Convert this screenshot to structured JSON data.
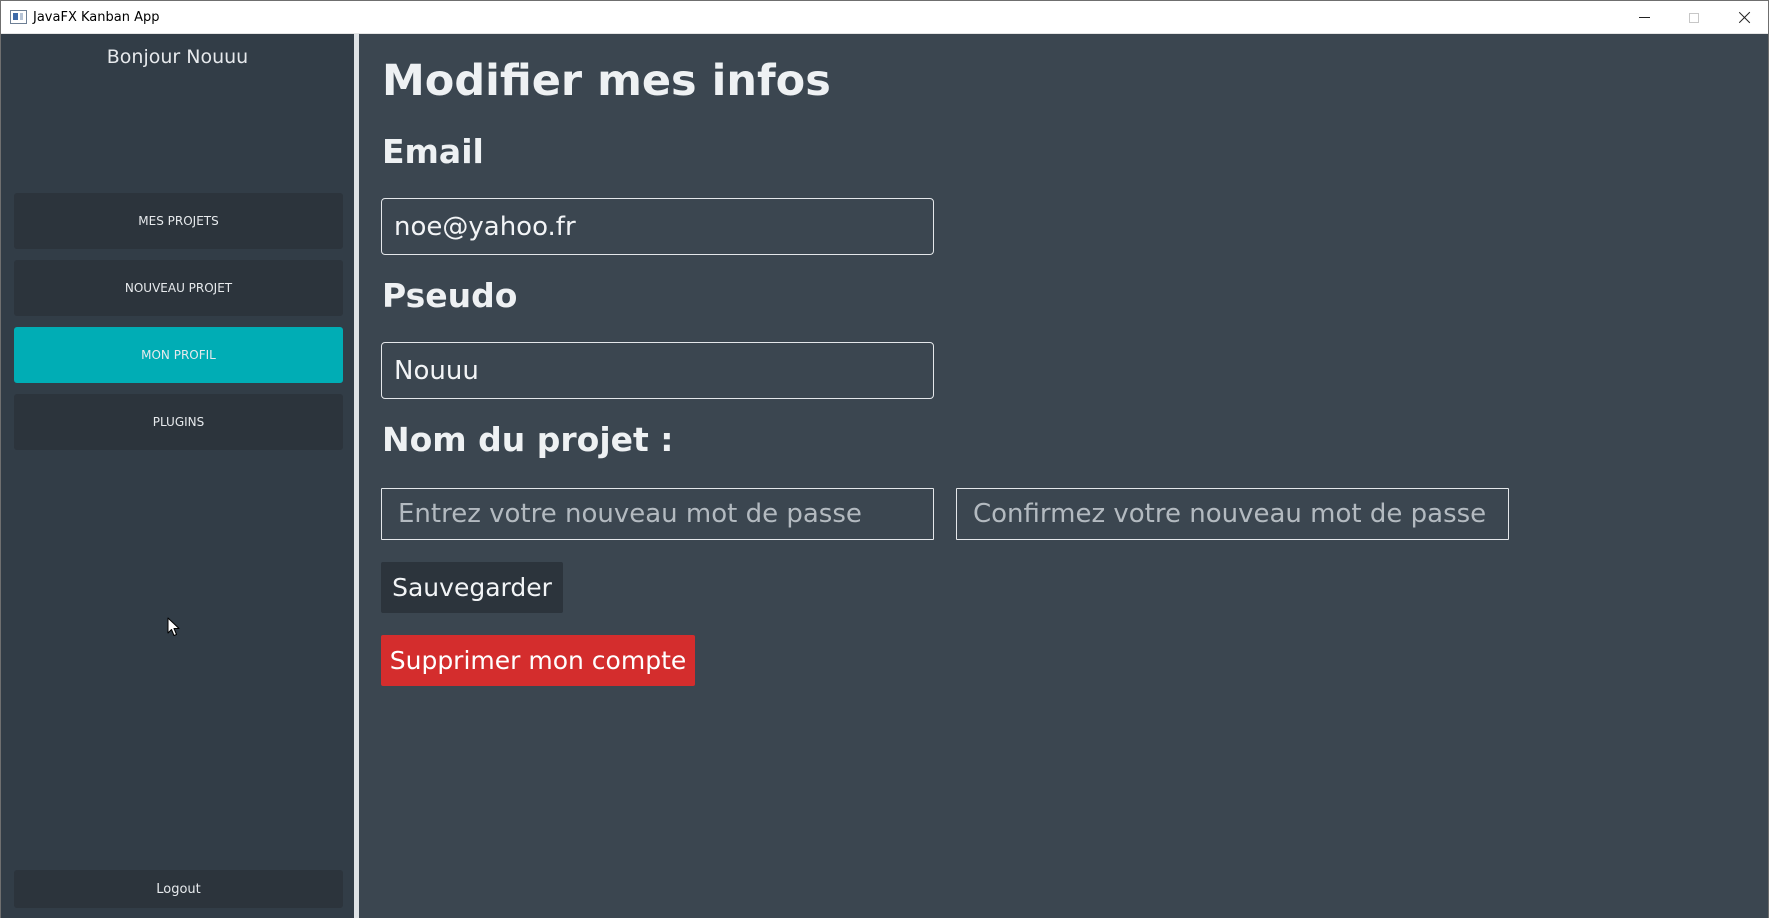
{
  "window": {
    "title": "JavaFX Kanban App",
    "icon": "app-window-icon",
    "controls": {
      "minimize_icon": "minimize-icon",
      "maximize_icon": "maximize-icon",
      "close_icon": "close-icon"
    }
  },
  "sidebar": {
    "greeting": "Bonjour Nouuu",
    "items": [
      {
        "label": "MES PROJETS",
        "active": false
      },
      {
        "label": "NOUVEAU PROJET",
        "active": false
      },
      {
        "label": "MON PROFIL",
        "active": true
      },
      {
        "label": "PLUGINS",
        "active": false
      }
    ],
    "logout_label": "Logout"
  },
  "main": {
    "title": "Modifier mes infos",
    "email": {
      "label": "Email",
      "value": "noe@yahoo.fr"
    },
    "pseudo": {
      "label": "Pseudo",
      "value": "Nouuu"
    },
    "password": {
      "label": "Nom du projet :",
      "new_placeholder": "Entrez votre nouveau mot de passe",
      "confirm_placeholder": "Confirmez votre nouveau mot de passe"
    },
    "save_label": "Sauvegarder",
    "delete_label": "Supprimer mon compte"
  },
  "colors": {
    "sidebar_bg": "#323d47",
    "main_bg": "#3b4650",
    "button_bg": "#2c343c",
    "accent": "#00adb5",
    "danger": "#d42d2d",
    "text": "#eef1f3"
  }
}
